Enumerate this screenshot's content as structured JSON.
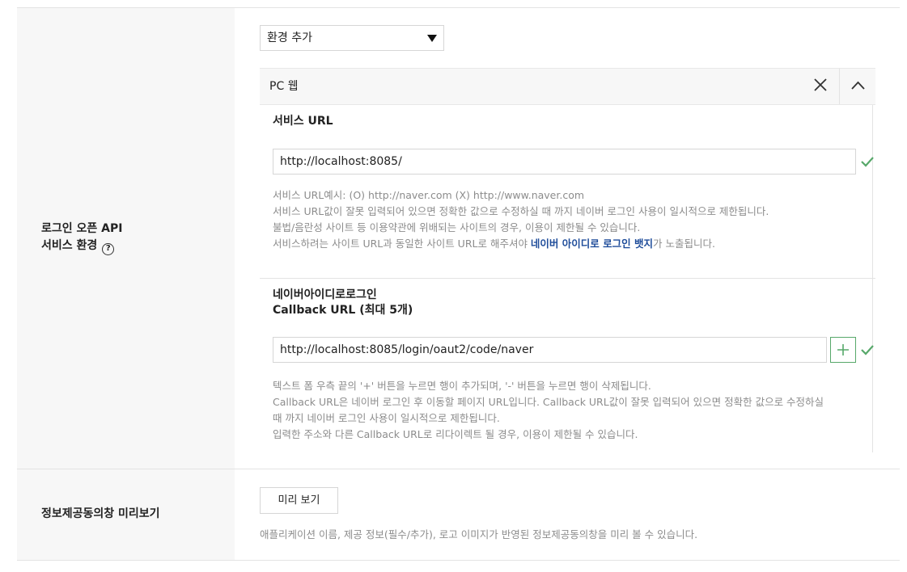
{
  "api_env": {
    "label_line1": "로그인 오픈 API",
    "label_line2": "서비스 환경",
    "help_symbol": "?",
    "add_env_select": {
      "value": "환경 추가"
    },
    "panel": {
      "title": "PC 웹",
      "service_url": {
        "title": "서비스 URL",
        "value": "http://localhost:8085/",
        "hints": [
          "서비스 URL예시: (O) http://naver.com (X) http://www.naver.com",
          "서비스 URL값이 잘못 입력되어 있으면 정확한 값으로 수정하실 때 까지 네이버 로그인 사용이 일시적으로 제한됩니다.",
          "불법/음란성 사이트 등 이용약관에 위배되는 사이트의 경우, 이용이 제한될 수 있습니다."
        ],
        "hint_last_pre": "서비스하려는 사이트 URL과 동일한 사이트 URL로 해주셔야 ",
        "hint_last_link": "네이버 아이디로 로그인 뱃지",
        "hint_last_post": "가 노출됩니다."
      },
      "callback": {
        "title_line1": "네이버아이디로로그인",
        "title_line2": "Callback URL (최대 5개)",
        "value": "http://localhost:8085/login/oaut2/code/naver",
        "hints": [
          "텍스트 폼 우측 끝의 '+' 버튼을 누르면 행이 추가되며, '-' 버튼을 누르면 행이 삭제됩니다.",
          "Callback URL은 네이버 로그인 후 이동할 페이지 URL입니다. Callback URL값이 잘못 입력되어 있으면 정확한 값으로 수정하실",
          "때 까지 네이버 로그인 사용이 일시적으로 제한됩니다.",
          "입력한 주소와 다른 Callback URL로 리다이렉트 될 경우, 이용이 제한될 수 있습니다."
        ]
      }
    }
  },
  "consent_preview": {
    "label": "정보제공동의창 미리보기",
    "button_label": "미리 보기",
    "hint": "애플리케이션 이름, 제공 정보(필수/추가), 로고 이미지가 반영된 정보제공동의창을 미리 볼 수 있습니다."
  },
  "colors": {
    "check": "#57a86a",
    "link": "#1e4c9a",
    "label_bg": "#f7f7f7",
    "hint_text": "#8c8c8c"
  },
  "icons": {
    "close": "close-icon",
    "collapse": "chevron-up-icon",
    "check": "check-icon",
    "plus": "plus-icon",
    "help": "help-icon",
    "dropdown": "caret-down-icon"
  }
}
